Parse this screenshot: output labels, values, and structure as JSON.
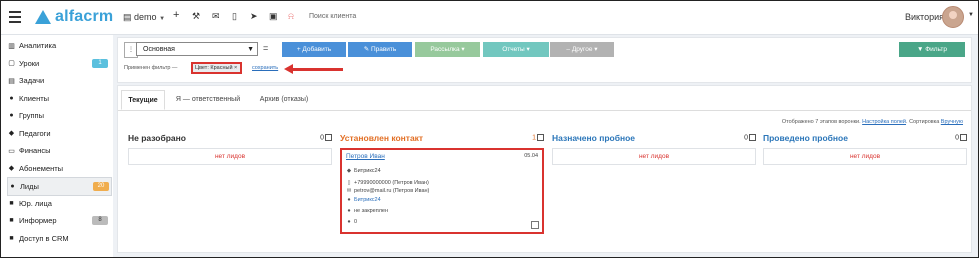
{
  "topbar": {
    "logo_text": "alfacrm",
    "account_label": "demo",
    "icons": [
      "plus-icon",
      "wrench-icon",
      "mail-icon",
      "phone-icon",
      "send-icon",
      "cart-icon",
      "bell-icon"
    ],
    "search_placeholder": "Поиск клиента",
    "user_name": "Виктория"
  },
  "sidebar": {
    "items": [
      {
        "label": "Аналитика",
        "icon": "chart-icon",
        "glyph": "▥",
        "badge": ""
      },
      {
        "label": "Уроки",
        "icon": "calendar-icon",
        "glyph": "▢",
        "badge": "1",
        "badge_color": "blue"
      },
      {
        "label": "Задачи",
        "icon": "tasks-icon",
        "glyph": "▤",
        "badge": ""
      },
      {
        "label": "Клиенты",
        "icon": "user-icon",
        "glyph": "●",
        "badge": ""
      },
      {
        "label": "Группы",
        "icon": "users-icon",
        "glyph": "●",
        "badge": ""
      },
      {
        "label": "Педагоги",
        "icon": "teacher-icon",
        "glyph": "◆",
        "badge": ""
      },
      {
        "label": "Финансы",
        "icon": "money-icon",
        "glyph": "▭",
        "badge": ""
      },
      {
        "label": "Абонементы",
        "icon": "tag-icon",
        "glyph": "◆",
        "badge": ""
      },
      {
        "label": "Лиды",
        "icon": "user-plus-icon",
        "glyph": "●",
        "badge": "20",
        "badge_color": "orange",
        "active": true
      },
      {
        "label": "Юр. лица",
        "icon": "briefcase-icon",
        "glyph": "■",
        "badge": ""
      },
      {
        "label": "Информер",
        "icon": "informer-icon",
        "glyph": "■",
        "badge": "8",
        "badge_color": "grey"
      },
      {
        "label": "Доступ в CRM",
        "icon": "lock-icon",
        "glyph": "■",
        "badge": ""
      }
    ]
  },
  "filter": {
    "field_label": "⋮",
    "select_value": "Основная",
    "eq_symbol": "=",
    "buttons": {
      "add": "+ Добавить",
      "edit": "✎ Править",
      "mailing": "Рассылка ▾",
      "reports": "Отчеты ▾",
      "other": "– Другое ▾",
      "filter": "▼ Фильтр"
    },
    "applied_text": "Применен фильтр —",
    "chip_text": "Цвет: Красный ×",
    "save_link": "сохранить"
  },
  "tabs": [
    "Текущие",
    "Я — ответственный",
    "Архив (отказы)"
  ],
  "meta": {
    "text_before": "Отображено 7 этапов воронки.",
    "settings_link": "Настройка полей",
    "sort_text": "Сортировка",
    "sort_link": "Вручную"
  },
  "columns": [
    {
      "title": "Не разобрано",
      "count": "0",
      "color": "dark",
      "empty_text": "нет лидов"
    },
    {
      "title": "Установлен контакт",
      "count": "1",
      "color": "orange",
      "empty_text": ""
    },
    {
      "title": "Назначено пробное",
      "count": "0",
      "color": "blue",
      "empty_text": "нет лидов"
    },
    {
      "title": "Проведено пробное",
      "count": "0",
      "color": "blue",
      "empty_text": "нет лидов"
    }
  ],
  "lead_card": {
    "name": "Петров Иван",
    "date": "05.04",
    "source": "Битрикс24",
    "phone": "+79990000000 (Петров Иван)",
    "email": "petrov@mail.ru (Петров Иван)",
    "link": "Битрикс24",
    "assigned": "не закреплен",
    "comments": "0"
  }
}
